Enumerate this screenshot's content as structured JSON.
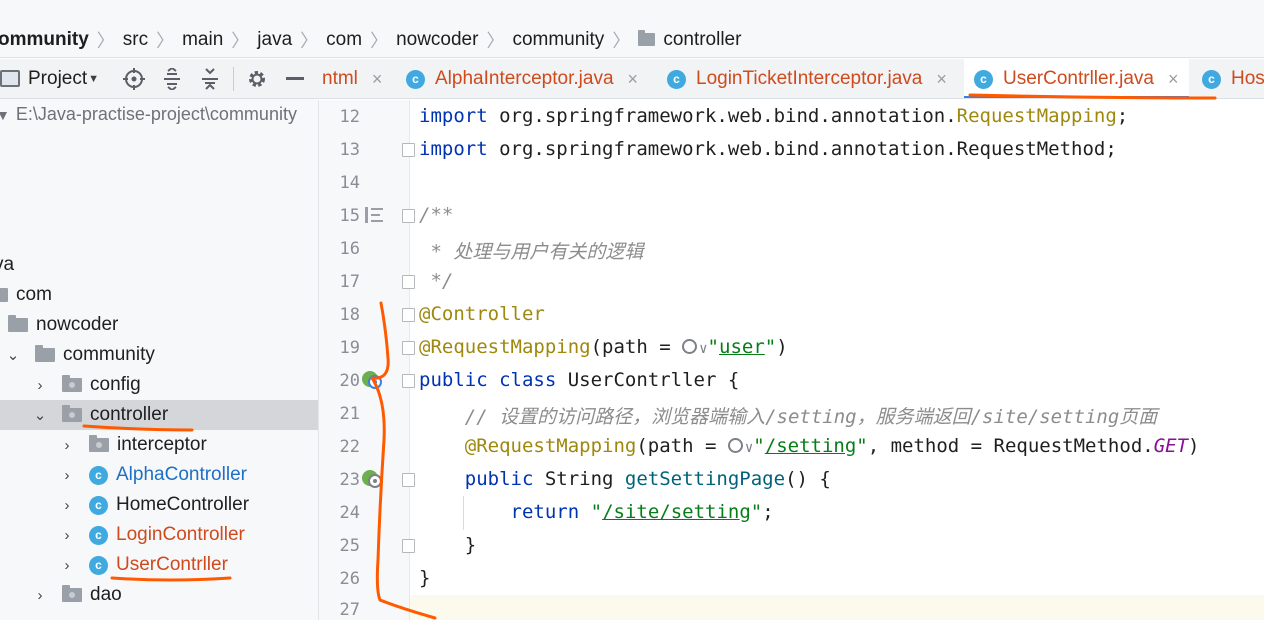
{
  "breadcrumb": {
    "items": [
      "ommunity",
      "src",
      "main",
      "java",
      "com",
      "nowcoder",
      "community",
      "controller"
    ]
  },
  "project_toolbar": {
    "label": "Project",
    "icons": [
      "project-icon",
      "crosshair-icon",
      "expand-all-icon",
      "collapse-all-icon",
      "gear-icon",
      "minimize-icon"
    ]
  },
  "tree": {
    "root_path": "E:\\Java-practise-project\\community",
    "items": [
      {
        "label": "va",
        "type": "text"
      },
      {
        "label": "com",
        "type": "folder"
      },
      {
        "label": "nowcoder",
        "type": "folder"
      },
      {
        "label": "community",
        "type": "folder"
      },
      {
        "label": "config",
        "type": "folder"
      },
      {
        "label": "controller",
        "type": "folder"
      },
      {
        "label": "interceptor",
        "type": "folder"
      },
      {
        "label": "AlphaController",
        "type": "class"
      },
      {
        "label": "HomeController",
        "type": "class"
      },
      {
        "label": "LoginController",
        "type": "class"
      },
      {
        "label": "UserContrller",
        "type": "class"
      },
      {
        "label": "dao",
        "type": "folder"
      }
    ]
  },
  "tabs": [
    {
      "label": "ntml",
      "active": false
    },
    {
      "label": "AlphaInterceptor.java",
      "active": false
    },
    {
      "label": "LoginTicketInterceptor.java",
      "active": false
    },
    {
      "label": "UserContrller.java",
      "active": true
    },
    {
      "label": "Hos",
      "active": false
    }
  ],
  "class_icon_letter": "c",
  "close_glyph": "×",
  "editor": {
    "line_numbers": [
      "12",
      "13",
      "14",
      "15",
      "16",
      "17",
      "18",
      "19",
      "20",
      "21",
      "22",
      "23",
      "24",
      "25",
      "26",
      "27"
    ],
    "code": {
      "l12_kw": "import",
      "l12_pkg": " org.springframework.web.bind.annotation.",
      "l12_cls": "RequestMapping",
      "l12_end": ";",
      "l13_kw": "import",
      "l13_rest": " org.springframework.web.bind.annotation.RequestMethod;",
      "l15": "/**",
      "l16": " * 处理与用户有关的逻辑",
      "l17": " */",
      "l18": "@Controller",
      "l19_ann": "@RequestMapping",
      "l19_mid": "(path = ",
      "l19_glyph": "∨",
      "l19_q1": "\"",
      "l19_str": "user",
      "l19_q2": "\"",
      "l19_end": ")",
      "l20_kw": "public class",
      "l20_rest": " UserContrller {",
      "l21": "    // 设置的访问路径，浏览器端输入/setting，服务端返回/site/setting页面",
      "l22_ann": "    @RequestMapping",
      "l22_mid": "(path = ",
      "l22_glyph": "∨",
      "l22_q1": "\"",
      "l22_str": "/setting",
      "l22_q2": "\"",
      "l22_mid2": ", method = RequestMethod.",
      "l22_const": "GET",
      "l22_end": ")",
      "l23_kw": "    public",
      "l23_type": " String ",
      "l23_mth": "getSettingPage",
      "l23_end": "() {",
      "l24_kw": "        return",
      "l24_sp": " ",
      "l24_q1": "\"",
      "l24_str": "/site/setting",
      "l24_q2": "\"",
      "l24_end": ";",
      "l25": "    }",
      "l26": "}"
    }
  },
  "colors": {
    "annotation_pen": "#ff5a00",
    "class_icon": "#3fa9e0",
    "keyword": "#0033b3",
    "string": "#067d17",
    "annotation": "#9e880d",
    "comment": "#8c8c8c"
  }
}
